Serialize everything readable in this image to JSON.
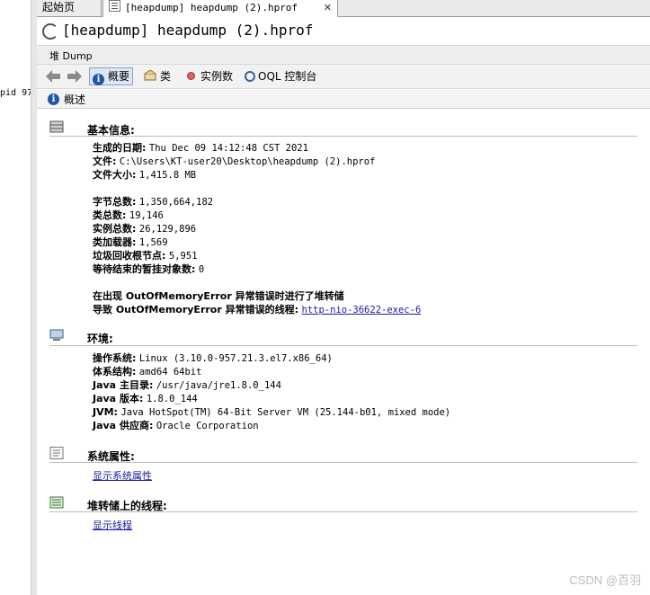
{
  "side": {
    "pid_text": "pid 97"
  },
  "tabs": [
    {
      "label": "起始页"
    },
    {
      "label": "[heapdump] heapdump (2).hprof",
      "close": "✕"
    }
  ],
  "title": "[heapdump] heapdump (2).hprof",
  "subbar": {
    "label": "堆 Dump"
  },
  "nav": {
    "items": [
      {
        "label": "概要",
        "icon": "info-icon",
        "active": true
      },
      {
        "label": "类",
        "icon": "class-icon"
      },
      {
        "label": "实例数",
        "icon": "dot-icon"
      },
      {
        "label": "OQL 控制台",
        "icon": "oql-icon"
      }
    ]
  },
  "overview": {
    "label": "概述"
  },
  "sections": {
    "basic": {
      "heading": "基本信息:",
      "rows": [
        {
          "k": "生成的日期:",
          "v": "Thu Dec 09 14:12:48 CST 2021"
        },
        {
          "k": "文件:",
          "v": "C:\\Users\\KT-user20\\Desktop\\heapdump (2).hprof"
        },
        {
          "k": "文件大小:",
          "v": "1,415.8 MB"
        },
        {
          "k": "字节总数:",
          "v": "1,350,664,182"
        },
        {
          "k": "类总数:",
          "v": "19,146"
        },
        {
          "k": "实例总数:",
          "v": "26,129,896"
        },
        {
          "k": "类加载器:",
          "v": "1,569"
        },
        {
          "k": "垃圾回收根节点:",
          "v": "5,951"
        },
        {
          "k": "等待结束的暂挂对象数:",
          "v": "0"
        }
      ],
      "oom_line1": "在出现 OutOfMemoryError 异常错误时进行了堆转储",
      "oom_line2_prefix": "导致 OutOfMemoryError 异常错误的线程:",
      "oom_thread_link": "http-nio-36622-exec-6"
    },
    "env": {
      "heading": "环境:",
      "rows": [
        {
          "k": "操作系统:",
          "v": "Linux (3.10.0-957.21.3.el7.x86_64)"
        },
        {
          "k": "体系结构:",
          "v": "amd64 64bit"
        },
        {
          "k": "Java 主目录:",
          "v": "/usr/java/jre1.8.0_144"
        },
        {
          "k": "Java 版本:",
          "v": "1.8.0_144"
        },
        {
          "k": "JVM:",
          "v": "Java HotSpot(TM) 64-Bit Server VM (25.144-b01, mixed mode)"
        },
        {
          "k": "Java 供应商:",
          "v": "Oracle Corporation"
        }
      ]
    },
    "sysprops": {
      "heading": "系统属性:",
      "link": "显示系统属性"
    },
    "threads": {
      "heading": "堆转储上的线程:",
      "link": "显示线程"
    }
  },
  "watermark": "CSDN @百羽"
}
